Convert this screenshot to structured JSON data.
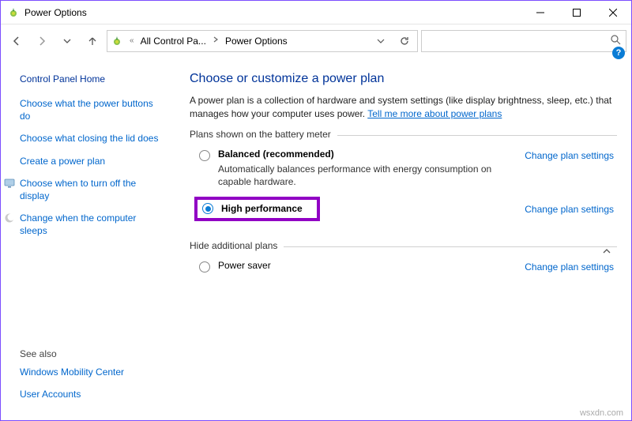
{
  "window": {
    "title": "Power Options"
  },
  "addressbar": {
    "segment1": "All Control Pa...",
    "segment2": "Power Options"
  },
  "help_glyph": "?",
  "sidebar": {
    "home": "Control Panel Home",
    "links": [
      "Choose what the power buttons do",
      "Choose what closing the lid does",
      "Create a power plan",
      "Choose when to turn off the display",
      "Change when the computer sleeps"
    ],
    "seealso_label": "See also",
    "seealso": [
      "Windows Mobility Center",
      "User Accounts"
    ]
  },
  "main": {
    "heading": "Choose or customize a power plan",
    "description_pre": "A power plan is a collection of hardware and system settings (like display brightness, sleep, etc.) that manages how your computer uses power. ",
    "description_link": "Tell me more about power plans",
    "group1_label": "Plans shown on the battery meter",
    "plan_balanced": {
      "name": "Balanced (recommended)",
      "sub": "Automatically balances performance with energy consumption on capable hardware.",
      "change": "Change plan settings"
    },
    "plan_high": {
      "name": "High performance",
      "change": "Change plan settings"
    },
    "group2_label": "Hide additional plans",
    "plan_saver": {
      "name": "Power saver",
      "change": "Change plan settings"
    }
  },
  "watermark": "wsxdn.com"
}
